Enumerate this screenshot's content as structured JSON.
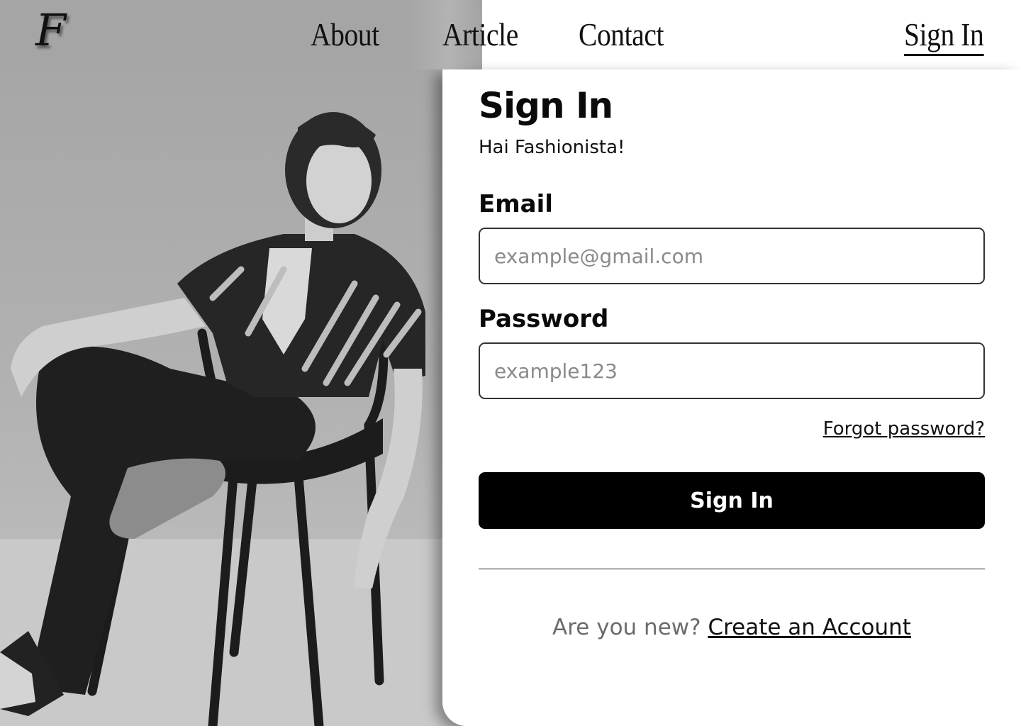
{
  "header": {
    "logo_letter": "F",
    "nav": {
      "about": "About",
      "article": "Article",
      "contact": "Contact",
      "sign_in": "Sign In"
    }
  },
  "form": {
    "title": "Sign In",
    "subtitle": "Hai Fashionista!",
    "email": {
      "label": "Email",
      "value": "",
      "placeholder": "example@gmail.com"
    },
    "password": {
      "label": "Password",
      "value": "",
      "placeholder": "example123"
    },
    "forgot_password": "Forgot password?",
    "submit_label": "Sign In",
    "new_user_prompt": "Are you new?",
    "create_account": "Create an Account"
  },
  "colors": {
    "accent": "#000000",
    "text": "#0a0a0a",
    "muted_text": "#6b6b6b",
    "placeholder": "#8a8a8a",
    "card_background": "#ffffff",
    "photo_background": "#b0b0b0"
  },
  "icons": {
    "logo": "script-f-logo-icon"
  }
}
